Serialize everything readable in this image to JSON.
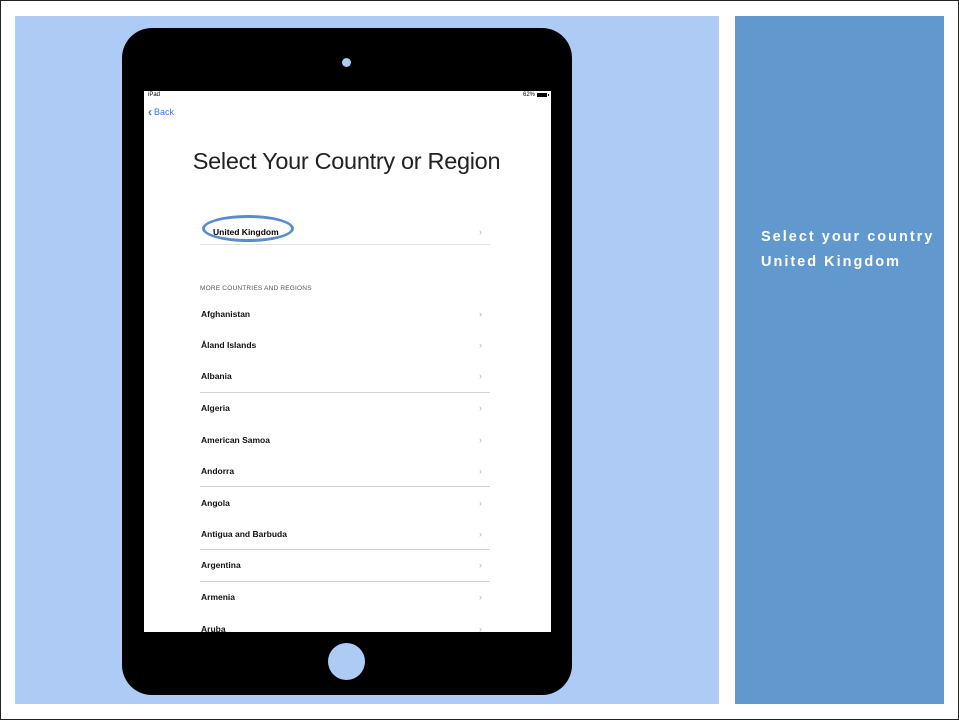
{
  "caption": {
    "line1": "Select your country",
    "line2": "United Kingdom"
  },
  "device": {
    "status": {
      "carrier": "iPad",
      "battery": "62%"
    },
    "back_label": "Back",
    "title": "Select Your Country or Region",
    "selected_country": "United Kingdom",
    "section_header": "MORE COUNTRIES AND REGIONS",
    "countries": [
      "Afghanistan",
      "Åland Islands",
      "Albania",
      "Algeria",
      "American Samoa",
      "Andorra",
      "Angola",
      "Antigua and Barbuda",
      "Argentina",
      "Armenia",
      "Aruba"
    ],
    "chevron": "›"
  }
}
